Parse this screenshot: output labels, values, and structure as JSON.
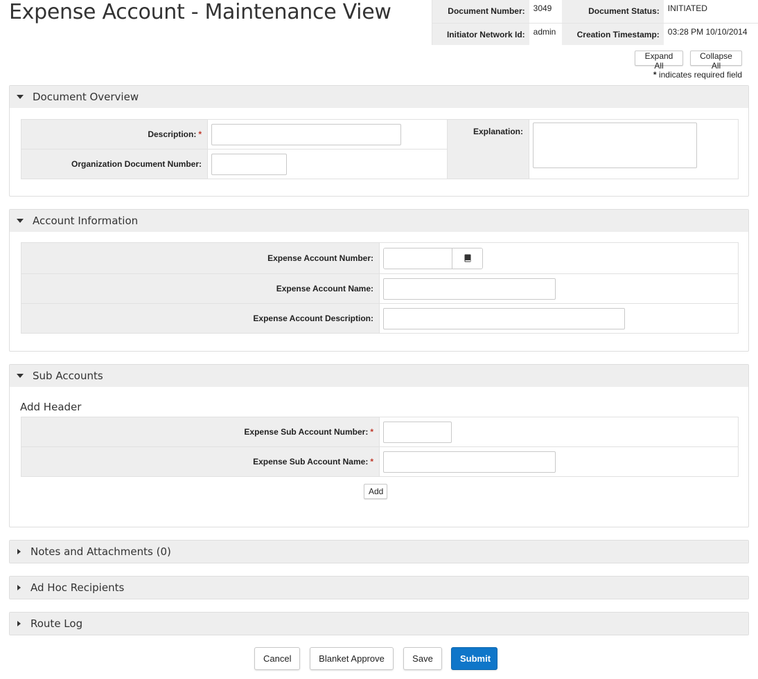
{
  "page": {
    "title": "Expense Account - Maintenance View"
  },
  "doc_header": {
    "document_number_label": "Document Number:",
    "document_number": "3049",
    "document_status_label": "Document Status:",
    "document_status": "INITIATED",
    "initiator_label": "Initiator Network Id:",
    "initiator": "admin",
    "creation_label": "Creation Timestamp:",
    "creation": "03:28 PM 10/10/2014"
  },
  "controls": {
    "expand_all": "Expand All",
    "collapse_all": "Collapse All",
    "required_star": "*",
    "required_note": " indicates required field"
  },
  "document_overview": {
    "title": "Document Overview",
    "description_label": "Description:",
    "description_value": "",
    "org_doc_number_label": "Organization Document Number:",
    "org_doc_number_value": "",
    "explanation_label": "Explanation:",
    "explanation_value": ""
  },
  "account_information": {
    "title": "Account Information",
    "number_label": "Expense Account Number:",
    "number_value": "",
    "name_label": "Expense Account Name:",
    "name_value": "",
    "description_label": "Expense Account Description:",
    "description_value": "",
    "lookup_icon": "book-icon"
  },
  "sub_accounts": {
    "title": "Sub Accounts",
    "add_header": "Add Header",
    "sub_number_label": "Expense Sub Account Number:",
    "sub_number_value": "",
    "sub_name_label": "Expense Sub Account Name:",
    "sub_name_value": "",
    "add_label": "Add"
  },
  "collapsed_sections": {
    "notes": "Notes and Attachments (0)",
    "adhoc": "Ad Hoc Recipients",
    "route_log": "Route Log"
  },
  "actions": {
    "cancel": "Cancel",
    "blanket_approve": "Blanket Approve",
    "save": "Save",
    "submit": "Submit"
  },
  "colors": {
    "primary": "#0f76c9",
    "panel_header": "#eeeeee",
    "required": "#c0392b"
  }
}
